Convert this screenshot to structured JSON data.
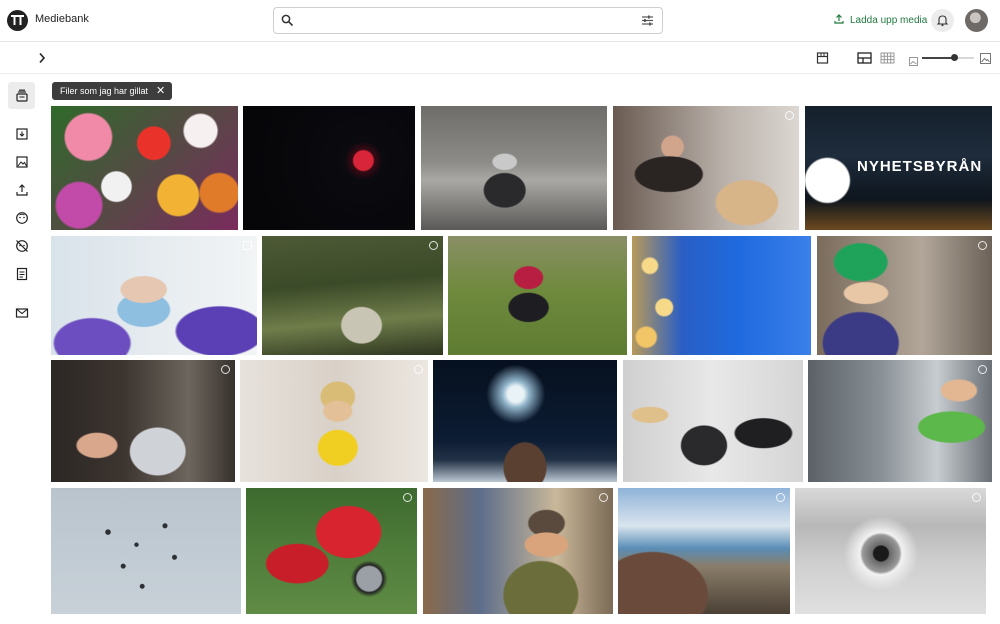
{
  "app": {
    "brand": "Mediebank"
  },
  "search": {
    "placeholder": "",
    "value": ""
  },
  "header": {
    "upload_label": "Ladda upp media"
  },
  "filter_chip": {
    "label": "Filer som jag har gillat"
  },
  "zoom": {
    "level": 0.62
  },
  "colors": {
    "accent_green": "#1f7a3f",
    "chip_bg": "#3d3d3d"
  },
  "sidebar": {
    "items": [
      {
        "name": "sidebar-item-liked",
        "icon": "stack-icon"
      },
      {
        "name": "sidebar-item-archive",
        "icon": "archive-icon"
      },
      {
        "name": "sidebar-item-images",
        "icon": "image-icon"
      },
      {
        "name": "sidebar-item-upload",
        "icon": "upload-icon"
      },
      {
        "name": "sidebar-item-faces",
        "icon": "face-icon"
      },
      {
        "name": "sidebar-item-hidden-faces",
        "icon": "face-off-icon"
      },
      {
        "name": "sidebar-item-documents",
        "icon": "document-icon"
      },
      {
        "name": "sidebar-item-messages",
        "icon": "mail-icon"
      }
    ]
  },
  "photos": [
    {
      "name": "photo-flowers",
      "subject": "dahlias"
    },
    {
      "name": "photo-red-moon",
      "subject": "moon"
    },
    {
      "name": "photo-cyclist-rain",
      "subject": "cyclist"
    },
    {
      "name": "photo-woman-parcel",
      "subject": "parcel"
    },
    {
      "name": "photo-nyhetsbyran-sign",
      "subject": "sign"
    },
    {
      "name": "photo-lab-vial",
      "subject": "lab"
    },
    {
      "name": "photo-landscape-path",
      "subject": "path"
    },
    {
      "name": "photo-runner-legs",
      "subject": "runner"
    },
    {
      "name": "photo-birds-lights",
      "subject": "birds"
    },
    {
      "name": "photo-hardhat-worker",
      "subject": "worker"
    },
    {
      "name": "photo-laptop-typing",
      "subject": "laptop"
    },
    {
      "name": "photo-woman-headphones",
      "subject": "headphones"
    },
    {
      "name": "photo-fireworks-village",
      "subject": "fireworks"
    },
    {
      "name": "photo-press-interview",
      "subject": "interview"
    },
    {
      "name": "photo-bus-driver",
      "subject": "driver"
    },
    {
      "name": "photo-planes-formation",
      "subject": "planes"
    },
    {
      "name": "photo-red-vintage-car",
      "subject": "car"
    },
    {
      "name": "photo-smiling-man",
      "subject": "portrait"
    },
    {
      "name": "photo-mountain-lake",
      "subject": "mountain"
    },
    {
      "name": "photo-eye-closeup",
      "subject": "eye"
    }
  ]
}
